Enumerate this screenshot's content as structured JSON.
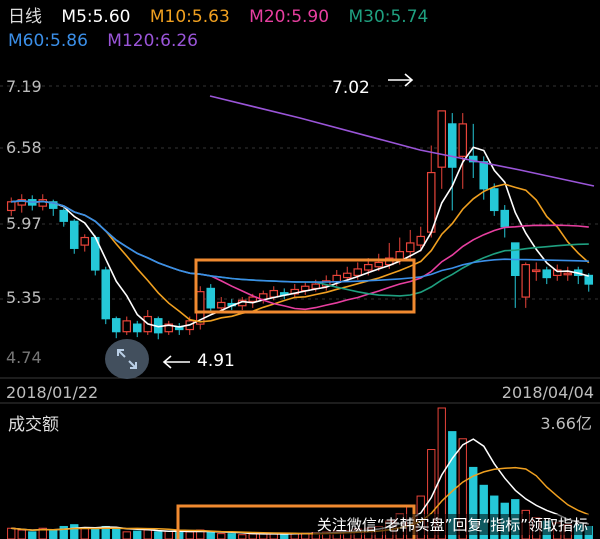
{
  "header": {
    "period": "日线",
    "ma": [
      {
        "label": "M5:5.60",
        "color": "#ffffff"
      },
      {
        "label": "M10:5.63",
        "color": "#f0a020"
      },
      {
        "label": "M20:5.90",
        "color": "#e83fa0"
      },
      {
        "label": "M30:5.74",
        "color": "#1fa080"
      },
      {
        "label": "M60:5.86",
        "color": "#3b8fe8"
      },
      {
        "label": "M120:6.26",
        "color": "#9a55d8"
      }
    ]
  },
  "volume": {
    "title": "成交额",
    "max_label": "3.66亿"
  },
  "watermark": "关注微信“老韩实盘”回复“指标”领取指标",
  "colors": {
    "up": "#e8443a",
    "down": "#25c8d8",
    "box": "#f08a30",
    "grid": "#333333"
  },
  "icons": [
    "zoom-icon",
    "arrow-right-icon",
    "arrow-left-icon"
  ],
  "chart_data": {
    "type": "candlestick",
    "ylim": [
      4.7,
      7.25
    ],
    "y_ticks": [
      "7.19",
      "6.58",
      "5.97",
      "5.35"
    ],
    "x_labels": [
      "2018/01/22",
      "2018/04/04"
    ],
    "annotations": [
      {
        "text": "7.02"
      },
      {
        "text": "4.91"
      }
    ],
    "ghost_label": "4.74",
    "candles": [
      [
        6.1,
        6.18,
        6.05,
        6.22
      ],
      [
        6.15,
        6.2,
        6.08,
        6.25
      ],
      [
        6.2,
        6.15,
        6.1,
        6.24
      ],
      [
        6.14,
        6.2,
        6.1,
        6.25
      ],
      [
        6.18,
        6.12,
        6.05,
        6.2
      ],
      [
        6.1,
        6.0,
        5.95,
        6.12
      ],
      [
        6.0,
        5.75,
        5.7,
        6.02
      ],
      [
        5.78,
        5.85,
        5.72,
        5.88
      ],
      [
        5.85,
        5.55,
        5.5,
        5.87
      ],
      [
        5.55,
        5.1,
        5.05,
        5.58
      ],
      [
        5.1,
        4.98,
        4.92,
        5.12
      ],
      [
        4.98,
        5.08,
        4.95,
        5.12
      ],
      [
        5.05,
        4.98,
        4.93,
        5.08
      ],
      [
        4.98,
        5.12,
        4.95,
        5.18
      ],
      [
        5.1,
        4.97,
        4.91,
        5.12
      ],
      [
        4.98,
        5.05,
        4.95,
        5.08
      ],
      [
        5.02,
        5.0,
        4.95,
        5.06
      ],
      [
        5.0,
        5.08,
        4.95,
        5.12
      ],
      [
        5.05,
        5.35,
        5.0,
        5.4
      ],
      [
        5.38,
        5.2,
        5.15,
        5.42
      ],
      [
        5.2,
        5.25,
        5.18,
        5.3
      ],
      [
        5.24,
        5.22,
        5.18,
        5.28
      ],
      [
        5.22,
        5.27,
        5.18,
        5.3
      ],
      [
        5.26,
        5.3,
        5.2,
        5.33
      ],
      [
        5.28,
        5.33,
        5.24,
        5.36
      ],
      [
        5.3,
        5.36,
        5.27,
        5.4
      ],
      [
        5.34,
        5.32,
        5.28,
        5.38
      ],
      [
        5.33,
        5.37,
        5.3,
        5.42
      ],
      [
        5.36,
        5.4,
        5.32,
        5.44
      ],
      [
        5.38,
        5.42,
        5.35,
        5.46
      ],
      [
        5.4,
        5.45,
        5.36,
        5.5
      ],
      [
        5.44,
        5.5,
        5.4,
        5.55
      ],
      [
        5.48,
        5.52,
        5.44,
        5.58
      ],
      [
        5.5,
        5.56,
        5.46,
        5.62
      ],
      [
        5.55,
        5.6,
        5.5,
        5.66
      ],
      [
        5.58,
        5.62,
        5.54,
        5.7
      ],
      [
        5.6,
        5.66,
        5.56,
        5.8
      ],
      [
        5.65,
        5.72,
        5.6,
        5.85
      ],
      [
        5.72,
        5.8,
        5.66,
        5.92
      ],
      [
        5.78,
        5.86,
        5.72,
        5.95
      ],
      [
        5.9,
        6.45,
        5.85,
        6.7
      ],
      [
        6.5,
        7.02,
        6.3,
        7.02
      ],
      [
        6.9,
        6.5,
        6.1,
        7.0
      ],
      [
        6.6,
        6.9,
        6.3,
        7.0
      ],
      [
        6.6,
        6.55,
        6.4,
        6.9
      ],
      [
        6.55,
        6.3,
        6.2,
        6.6
      ],
      [
        6.3,
        6.1,
        6.05,
        6.35
      ],
      [
        6.1,
        5.95,
        5.85,
        6.15
      ],
      [
        5.8,
        5.5,
        5.2,
        5.8
      ],
      [
        5.3,
        5.6,
        5.2,
        5.62
      ],
      [
        5.55,
        5.55,
        5.45,
        5.62
      ],
      [
        5.55,
        5.48,
        5.42,
        5.58
      ],
      [
        5.5,
        5.55,
        5.45,
        5.6
      ],
      [
        5.52,
        5.52,
        5.45,
        5.58
      ],
      [
        5.55,
        5.5,
        5.42,
        5.58
      ],
      [
        5.5,
        5.42,
        5.35,
        5.52
      ]
    ],
    "volume": [
      0.3,
      0.25,
      0.2,
      0.3,
      0.25,
      0.35,
      0.4,
      0.3,
      0.28,
      0.35,
      0.3,
      0.2,
      0.22,
      0.25,
      0.2,
      0.22,
      0.18,
      0.2,
      0.25,
      0.2,
      0.15,
      0.15,
      0.12,
      0.14,
      0.15,
      0.15,
      0.14,
      0.15,
      0.16,
      0.18,
      0.2,
      0.22,
      0.24,
      0.28,
      0.3,
      0.35,
      0.5,
      0.7,
      0.9,
      1.2,
      2.5,
      3.66,
      3.0,
      2.8,
      2.0,
      1.5,
      1.2,
      1.0,
      1.1,
      0.8,
      0.6,
      0.5,
      0.45,
      0.4,
      0.4,
      0.35
    ]
  }
}
